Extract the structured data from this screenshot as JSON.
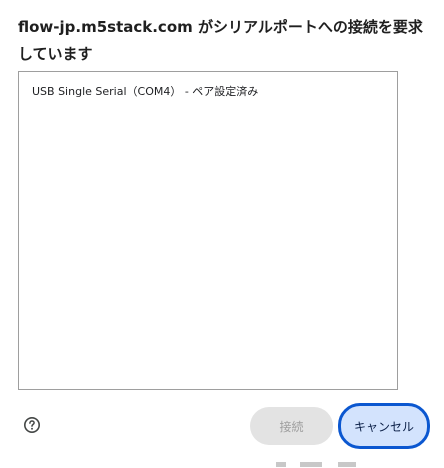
{
  "dialog": {
    "title": "flow-jp.m5stack.com がシリアルポートへの接続を要求しています"
  },
  "port_list": {
    "items": [
      {
        "label": "USB Single Serial（COM4） - ペア設定済み"
      }
    ]
  },
  "footer": {
    "help_icon": "help-circle-icon",
    "connect_label": "接続",
    "connect_enabled": false,
    "cancel_label": "キャンセル"
  },
  "colors": {
    "accent": "#0b57d0",
    "cancel_bg": "#d3e3fd",
    "disabled_bg": "#e3e3e3",
    "disabled_text": "#9e9e9e",
    "list_border": "#9e9e9e"
  }
}
